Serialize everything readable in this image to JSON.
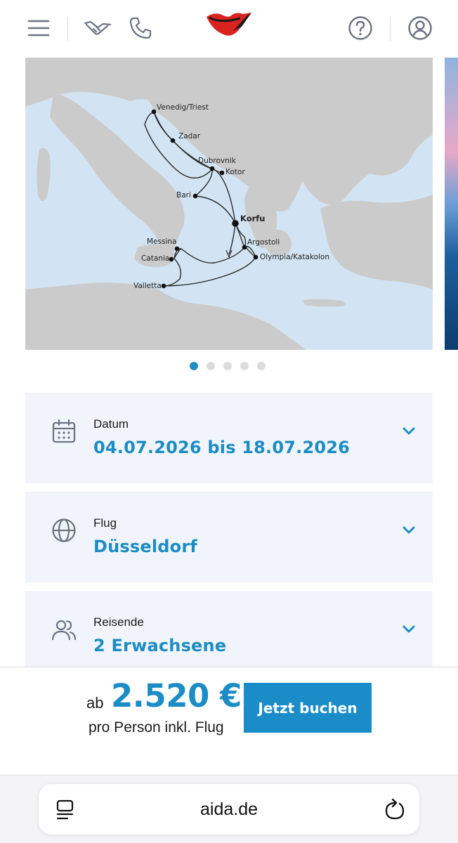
{
  "header": {
    "icons": [
      "menu-icon",
      "handshake-icon",
      "phone-icon",
      "aida-lips-logo",
      "help-icon",
      "account-icon"
    ]
  },
  "map": {
    "ports": [
      {
        "name": "Venedig/Triest",
        "bold": false
      },
      {
        "name": "Zadar",
        "bold": false
      },
      {
        "name": "Dubrovnik",
        "bold": false
      },
      {
        "name": "Kotor",
        "bold": false
      },
      {
        "name": "Bari",
        "bold": false
      },
      {
        "name": "Korfu",
        "bold": true
      },
      {
        "name": "Argostoli",
        "bold": false
      },
      {
        "name": "Olympia/Katakolon",
        "bold": false
      },
      {
        "name": "Messina",
        "bold": false
      },
      {
        "name": "Catania",
        "bold": false
      },
      {
        "name": "Valletta",
        "bold": false
      }
    ],
    "slide_count": 5,
    "active_slide": 1
  },
  "cards": [
    {
      "label": "Datum",
      "value": "04.07.2026 bis 18.07.2026",
      "icon": "calendar-icon"
    },
    {
      "label": "Flug",
      "value": "Düsseldorf",
      "icon": "globe-icon"
    },
    {
      "label": "Reisende",
      "value": "2 Erwachsene",
      "icon": "travelers-icon"
    }
  ],
  "booking": {
    "prefix": "ab",
    "price": "2.520 €",
    "subline": "pro Person inkl. Flug",
    "button": "Jetzt buchen"
  },
  "browser": {
    "url": "aida.de"
  },
  "colors": {
    "accent": "#1c8cc4",
    "card_bg": "#f1f5fb",
    "logo_red": "#d8231f",
    "icon_gray": "#6b7280"
  }
}
